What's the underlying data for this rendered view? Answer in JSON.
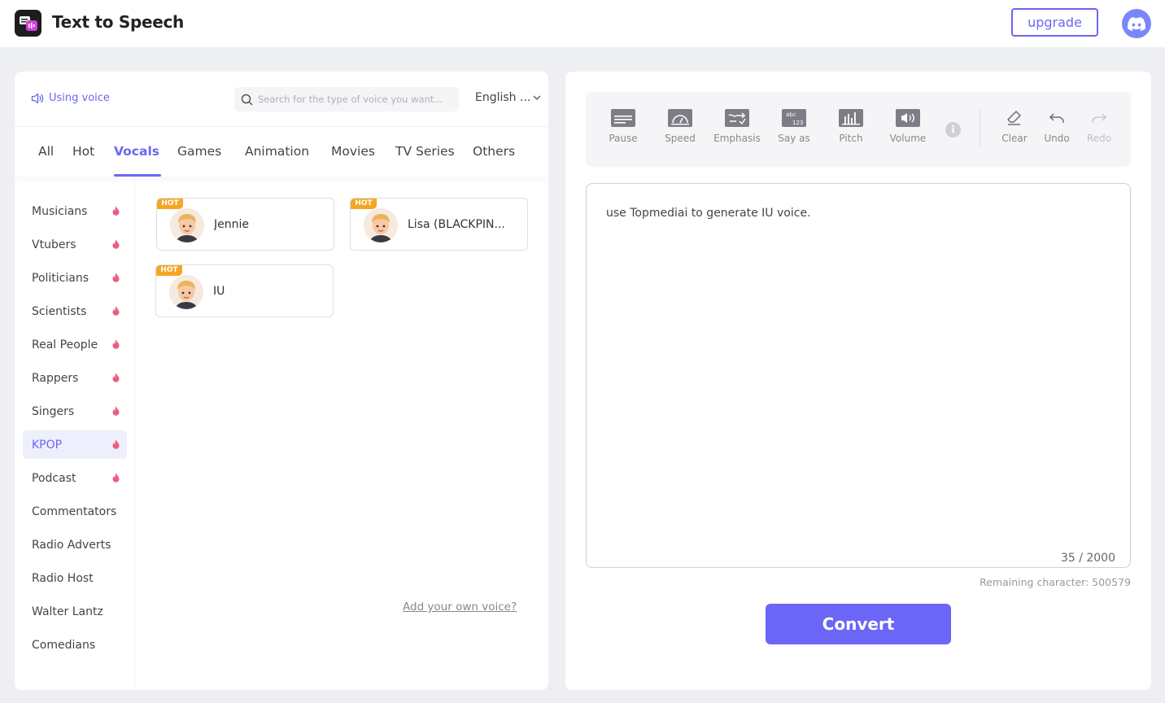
{
  "app": {
    "title": "Text to Speech"
  },
  "header": {
    "upgrade_label": "upgrade",
    "discord_icon": "discord-icon"
  },
  "voice_panel": {
    "using_voice_label": "Using voice",
    "search_placeholder": "Search for the type of voice you want...",
    "language": "English ...",
    "tabs": [
      "All",
      "Hot",
      "Vocals",
      "Games",
      "Animation",
      "Movies",
      "TV Series",
      "Others"
    ],
    "active_tab": "Vocals",
    "categories": [
      {
        "label": "Musicians",
        "hot": true
      },
      {
        "label": "Vtubers",
        "hot": true
      },
      {
        "label": "Politicians",
        "hot": true
      },
      {
        "label": "Scientists",
        "hot": true
      },
      {
        "label": "Real People",
        "hot": true
      },
      {
        "label": "Rappers",
        "hot": true
      },
      {
        "label": "Singers",
        "hot": true
      },
      {
        "label": "KPOP",
        "hot": true
      },
      {
        "label": "Podcast",
        "hot": true
      },
      {
        "label": "Commentators",
        "hot": false
      },
      {
        "label": "Radio Adverts",
        "hot": false
      },
      {
        "label": "Radio Host",
        "hot": false
      },
      {
        "label": "Walter Lantz",
        "hot": false
      },
      {
        "label": "Comedians",
        "hot": false
      }
    ],
    "active_category": "KPOP",
    "hot_badge": "HOT",
    "voices": [
      {
        "name": "Jennie",
        "badge": "HOT"
      },
      {
        "name": "Lisa (BLACKPIN...",
        "badge": "HOT"
      },
      {
        "name": "IU",
        "badge": "HOT"
      }
    ],
    "add_voice_link": "Add your own voice?"
  },
  "editor_panel": {
    "tools": [
      {
        "label": "Pause",
        "icon": "pause-icon"
      },
      {
        "label": "Speed",
        "icon": "speedometer-icon"
      },
      {
        "label": "Emphasis",
        "icon": "emphasis-icon"
      },
      {
        "label": "Say as",
        "icon": "say-as-icon"
      },
      {
        "label": "Pitch",
        "icon": "pitch-icon"
      },
      {
        "label": "Volume",
        "icon": "volume-icon"
      }
    ],
    "info_glyph": "i",
    "actions": [
      {
        "label": "Clear",
        "icon": "eraser-icon"
      },
      {
        "label": "Undo",
        "icon": "undo-icon"
      },
      {
        "label": "Redo",
        "icon": "redo-icon"
      }
    ],
    "text": "use Topmediai to generate IU voice.",
    "char_count": "35 / 2000",
    "remaining": "Remaining character: 500579",
    "convert_label": "Convert"
  },
  "colors": {
    "accent": "#6b66f6",
    "hot": "#f5a623",
    "fire": "#ee5b7e"
  }
}
